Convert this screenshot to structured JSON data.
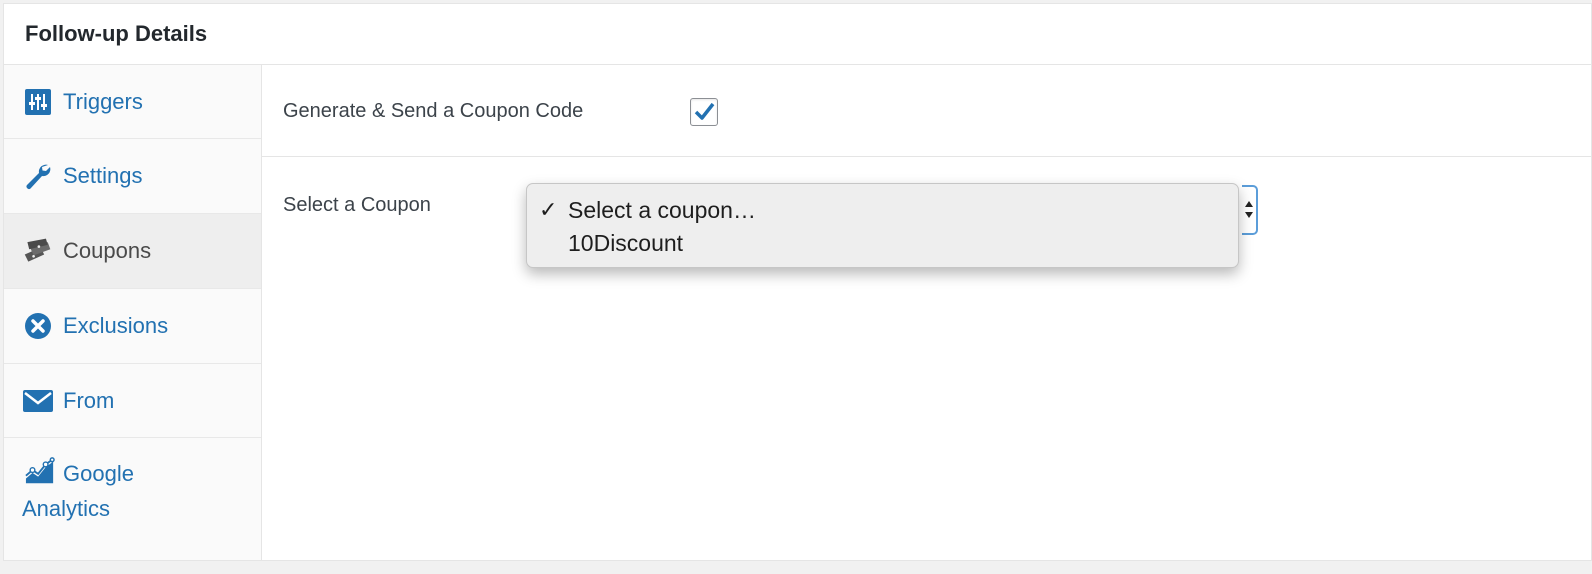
{
  "panel": {
    "title": "Follow-up Details"
  },
  "tabs": [
    {
      "label": "Triggers",
      "icon": "sliders-icon"
    },
    {
      "label": "Settings",
      "icon": "wrench-icon"
    },
    {
      "label": "Coupons",
      "icon": "tickets-icon",
      "active": true
    },
    {
      "label": "Exclusions",
      "icon": "x-circle-icon"
    },
    {
      "label": "From",
      "icon": "envelope-icon"
    },
    {
      "label_line1": "Google",
      "label_line2": "Analytics",
      "icon": "chart-icon"
    }
  ],
  "coupon_settings": {
    "generate_label": "Generate & Send a Coupon Code",
    "generate_checked": true,
    "select_label": "Select a Coupon",
    "options": [
      {
        "label": "Select a coupon…",
        "selected": true
      },
      {
        "label": "10Discount",
        "selected": false
      }
    ],
    "check_mark": "✓"
  },
  "colors": {
    "link": "#2271b1",
    "focus": "#5b9dd9"
  }
}
